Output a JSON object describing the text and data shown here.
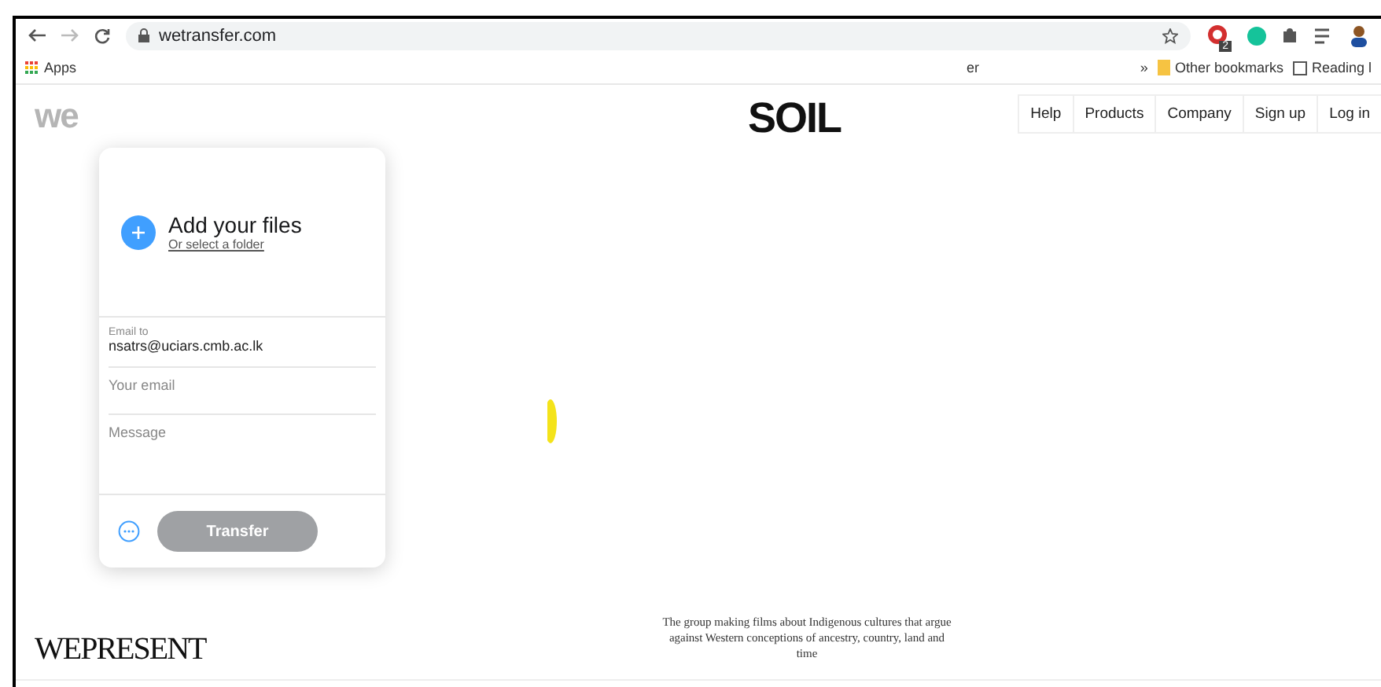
{
  "browser": {
    "url": "wetransfer.com",
    "bookmarks": [
      {
        "label": "Apps",
        "kind": "apps"
      },
      {
        "label": "er",
        "kind": "link"
      }
    ],
    "overflow": "»",
    "other_bookmarks": "Other bookmarks",
    "reading_list": "Reading l",
    "extension_badge": "2"
  },
  "site": {
    "logo": "we",
    "nav": [
      "Help",
      "Products",
      "Company",
      "Sign up",
      "Log in"
    ],
    "headline": "SOIL",
    "caption": "The group making films about Indigenous cultures that argue against Western conceptions of ancestry, country, land and time",
    "brand": "WEPRESENT"
  },
  "upload": {
    "title": "Add your files",
    "folder_link": "Or select a folder",
    "email_to": {
      "label": "Email to",
      "value": "nsatrs@uciars.cmb.ac.lk"
    },
    "your_email": {
      "placeholder": "Your email"
    },
    "message": {
      "placeholder": "Message"
    },
    "transfer": {
      "label": "Transfer",
      "disabled": true
    }
  }
}
